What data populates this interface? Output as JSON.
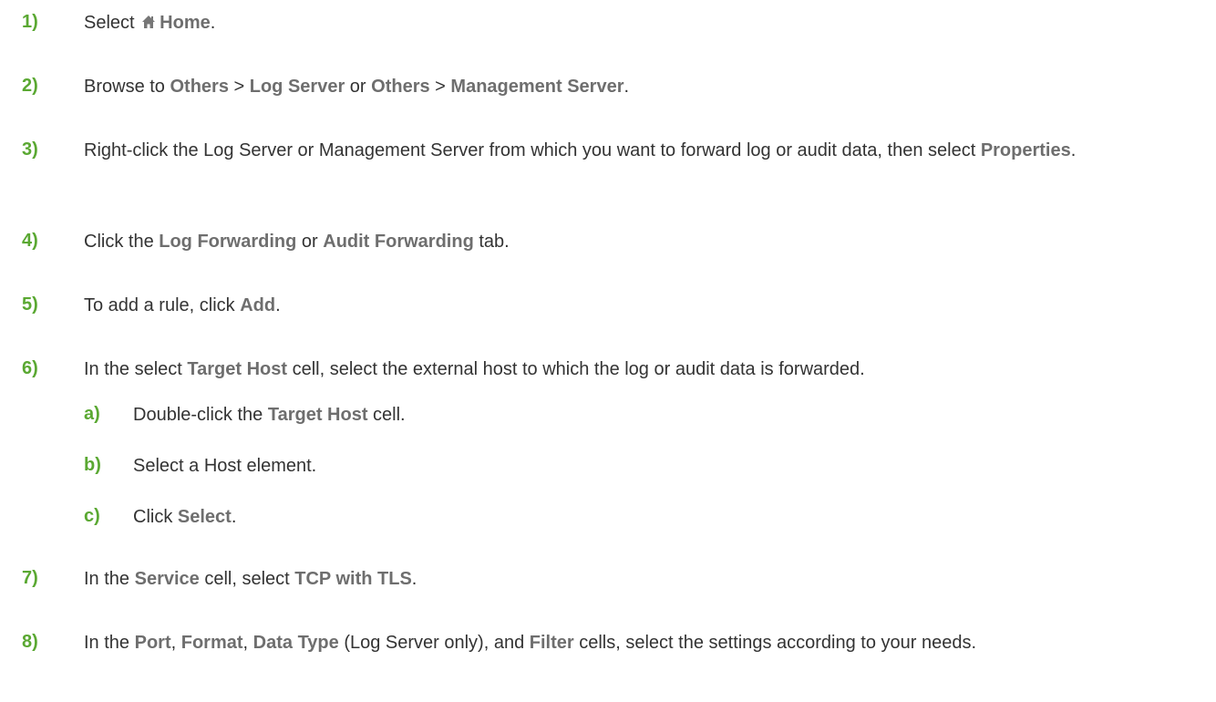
{
  "steps": [
    {
      "num": "1)",
      "t0": "Select ",
      "icon": "home-icon",
      "b1": "Home",
      "t1": "."
    },
    {
      "num": "2)",
      "t0": "Browse to ",
      "b1": "Others",
      "t1": " > ",
      "b2": "Log Server",
      "t2": " or ",
      "b3": "Others",
      "t3": " > ",
      "b4": "Management Server",
      "t4": "."
    },
    {
      "num": "3)",
      "t0": "Right-click the Log Server or Management Server from which you want to forward log or audit data, then select ",
      "b1": "Properties",
      "t1": "."
    },
    {
      "num": "4)",
      "t0": "Click the ",
      "b1": "Log Forwarding",
      "t1": " or ",
      "b2": "Audit Forwarding",
      "t2": " tab."
    },
    {
      "num": "5)",
      "t0": "To add a rule, click ",
      "b1": "Add",
      "t1": "."
    },
    {
      "num": "6)",
      "t0": "In the select ",
      "b1": "Target Host",
      "t1": " cell, select the external host to which the log or audit data is forwarded.",
      "substeps": [
        {
          "num": "a)",
          "t0": "Double-click the ",
          "b1": "Target Host",
          "t1": " cell."
        },
        {
          "num": "b)",
          "t0": "Select a Host element."
        },
        {
          "num": "c)",
          "t0": "Click ",
          "b1": "Select",
          "t1": "."
        }
      ]
    },
    {
      "num": "7)",
      "t0": "In the ",
      "b1": "Service",
      "t1": " cell, select ",
      "b2": "TCP with TLS",
      "t2": "."
    },
    {
      "num": "8)",
      "t0": "In the ",
      "b1": "Port",
      "t1": ", ",
      "b2": "Format",
      "t2": ", ",
      "b3": "Data Type",
      "t3": " (Log Server only), and ",
      "b4": "Filter",
      "t4": " cells, select the settings according to your needs."
    }
  ],
  "colors": {
    "step_number": "#5aa832",
    "bold_term": "#6e6e6e",
    "body_text": "#333333"
  }
}
